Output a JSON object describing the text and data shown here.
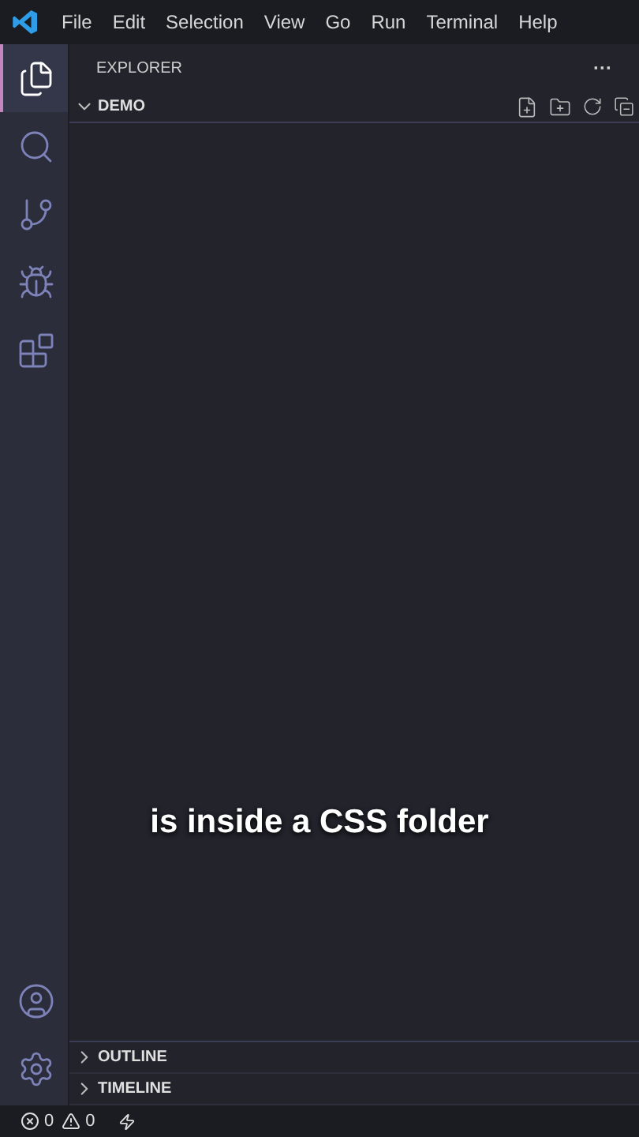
{
  "menu": [
    "File",
    "Edit",
    "Selection",
    "View",
    "Go",
    "Run",
    "Terminal",
    "Help"
  ],
  "activity_bar": {
    "top": [
      {
        "kind": "files",
        "selected": true
      },
      {
        "kind": "search",
        "selected": false
      },
      {
        "kind": "source-control",
        "selected": false
      },
      {
        "kind": "run",
        "selected": false
      },
      {
        "kind": "extensions",
        "selected": false
      }
    ],
    "bottom": [
      {
        "kind": "account"
      },
      {
        "kind": "settings"
      }
    ]
  },
  "explorer": {
    "title": "EXPLORER",
    "more": "···",
    "folder": {
      "name": "DEMO",
      "expanded": true
    }
  },
  "panels": [
    {
      "name": "OUTLINE",
      "expanded": false
    },
    {
      "name": "TIMELINE",
      "expanded": false
    }
  ],
  "status_bar": {
    "errors": "0",
    "warnings": "0"
  },
  "caption": "is inside a CSS folder"
}
